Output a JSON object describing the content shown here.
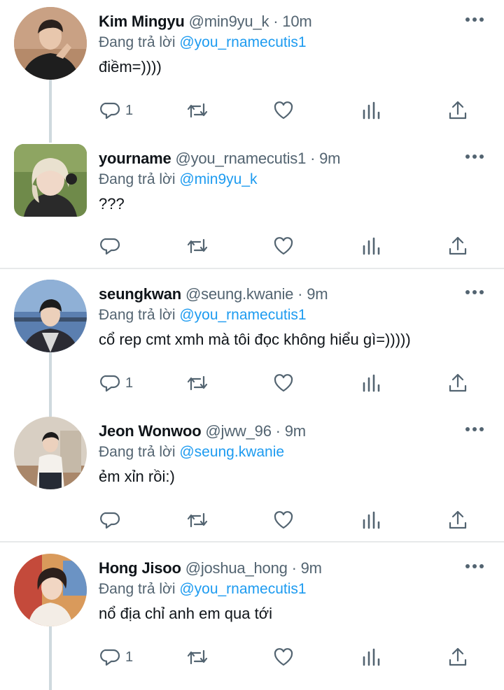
{
  "reply_prefix": "Đang trả lời",
  "dot": "·",
  "colors": {
    "text": "#0f1419",
    "secondary": "#536471",
    "accent": "#1d9bf0",
    "thread_line": "#cfd9de",
    "divider": "#e7e9ea"
  },
  "action_icons": [
    "reply-icon",
    "retweet-icon",
    "like-icon",
    "analytics-icon",
    "share-icon"
  ],
  "tweets": [
    {
      "name": "Kim Mingyu",
      "handle": "@min9yu_k",
      "time": "10m",
      "reply_to": "@you_rnamecutis1",
      "text": "điềm=))))",
      "reply_count": "1"
    },
    {
      "name": "yourname",
      "handle": "@you_rnamecutis1",
      "time": "9m",
      "reply_to": "@min9yu_k",
      "text": "???",
      "reply_count": ""
    },
    {
      "name": "seungkwan",
      "handle": "@seung.kwanie",
      "time": "9m",
      "reply_to": "@you_rnamecutis1",
      "text": "cổ rep cmt xmh mà tôi đọc không hiểu gì=)))))",
      "reply_count": "1"
    },
    {
      "name": "Jeon Wonwoo",
      "handle": "@jww_96",
      "time": "9m",
      "reply_to": "@seung.kwanie",
      "text": "ẻm xỉn rồi:)",
      "reply_count": ""
    },
    {
      "name": "Hong Jisoo",
      "handle": "@joshua_hong",
      "time": "9m",
      "reply_to": "@you_rnamecutis1",
      "text": "nổ địa chỉ anh em qua tới",
      "reply_count": "1"
    }
  ]
}
